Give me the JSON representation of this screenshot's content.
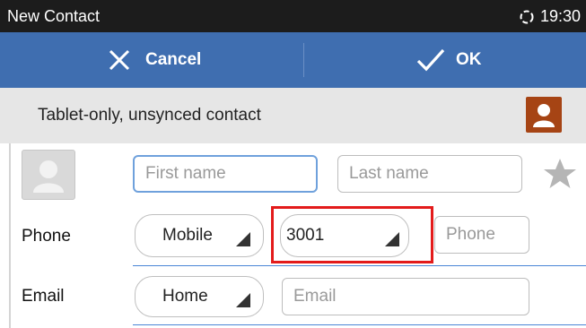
{
  "status_bar": {
    "title": "New Contact",
    "time": "19:30",
    "sync_icon": "sync-icon"
  },
  "action_bar": {
    "cancel_label": "Cancel",
    "ok_label": "OK",
    "background": "#3f6eb0"
  },
  "account_bar": {
    "text": "Tablet-only, unsynced contact",
    "badge_color": "#a64414"
  },
  "name_row": {
    "first_placeholder": "First name",
    "last_placeholder": "Last name"
  },
  "phone_row": {
    "label": "Phone",
    "type_selected": "Mobile",
    "line_selected": "3001",
    "placeholder": "Phone"
  },
  "email_row": {
    "label": "Email",
    "type_selected": "Home",
    "placeholder": "Email"
  },
  "colors": {
    "accent_underline": "#4a86d6",
    "highlight": "#e31b1b"
  }
}
